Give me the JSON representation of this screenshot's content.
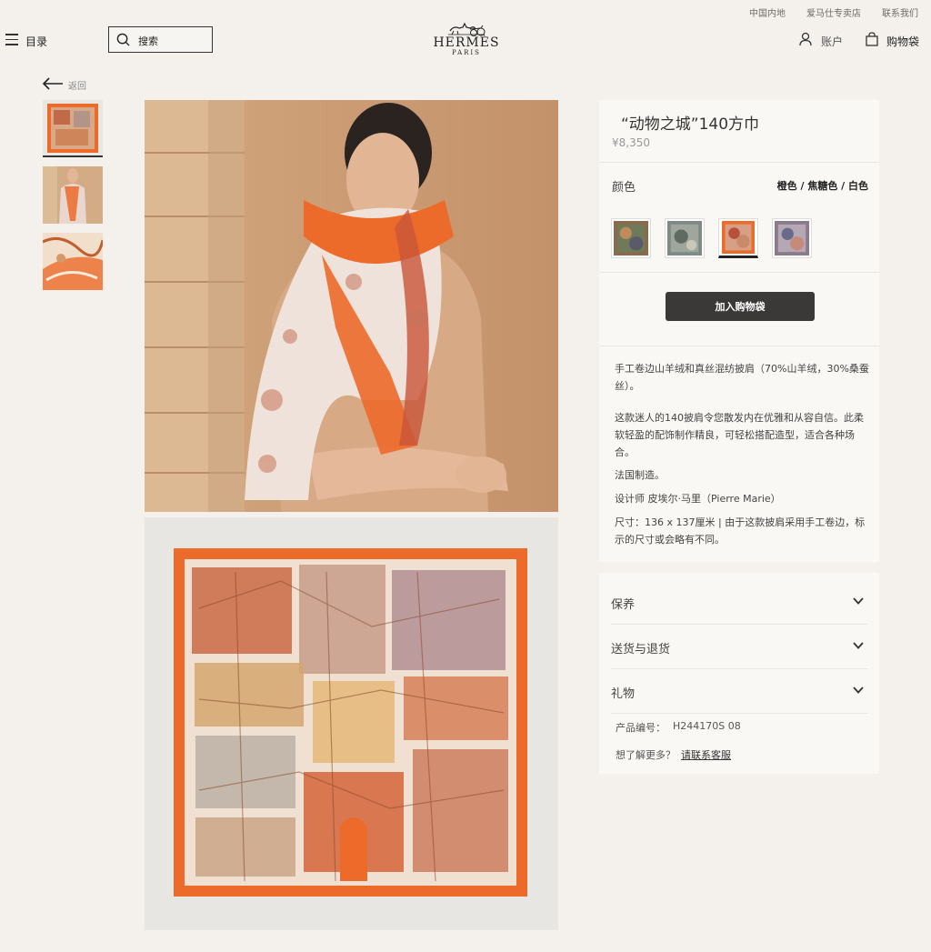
{
  "utility_nav": {
    "region": "中国内地",
    "stores": "爱马仕专卖店",
    "contact": "联系我们"
  },
  "header": {
    "menu_label": "目录",
    "search_label": "搜索",
    "logo_word": "HERMÈS",
    "logo_city": "PARIS",
    "account_label": "账户",
    "bag_label": "购物袋"
  },
  "back_label": "返回",
  "product": {
    "title": "“动物之城”140方巾",
    "price": "¥8,350",
    "color_label": "颜色",
    "color_value": "橙色 / 焦糖色 / 白色",
    "swatches": [
      {
        "name": "swatch-1",
        "color": "#8a6a4a"
      },
      {
        "name": "swatch-2",
        "color": "#7e8a84"
      },
      {
        "name": "swatch-3",
        "color": "#c4653a"
      },
      {
        "name": "swatch-4",
        "color": "#8a7a8a"
      }
    ],
    "selected_swatch": 3,
    "add_to_bag": "加入购物袋",
    "description": [
      "手工卷边山羊绒和真丝混纺披肩（70%山羊绒，30%桑蚕丝）。",
      "这款迷人的140披肩令您散发内在优雅和从容自信。此柔软轻盈的配饰制作精良，可轻松搭配造型，适合各种场合。",
      "法国制造。",
      "设计师 皮埃尔·马里（Pierre Marie）",
      "尺寸：136 x 137厘米 | 由于这款披肩采用手工卷边，标示的尺寸或会略有不同。"
    ]
  },
  "accordion": {
    "care": "保养",
    "shipping": "送货与退货",
    "gift": "礼物"
  },
  "info": {
    "sku_label": "产品编号：",
    "sku_value": "H244170S 08",
    "more_label": "想了解更多？",
    "contact_link": "请联系客服"
  },
  "colors": {
    "background": "#f4f1ec",
    "panel": "#faf8f4",
    "button": "#3b3838",
    "scarf_orange": "#ec6a2a"
  }
}
